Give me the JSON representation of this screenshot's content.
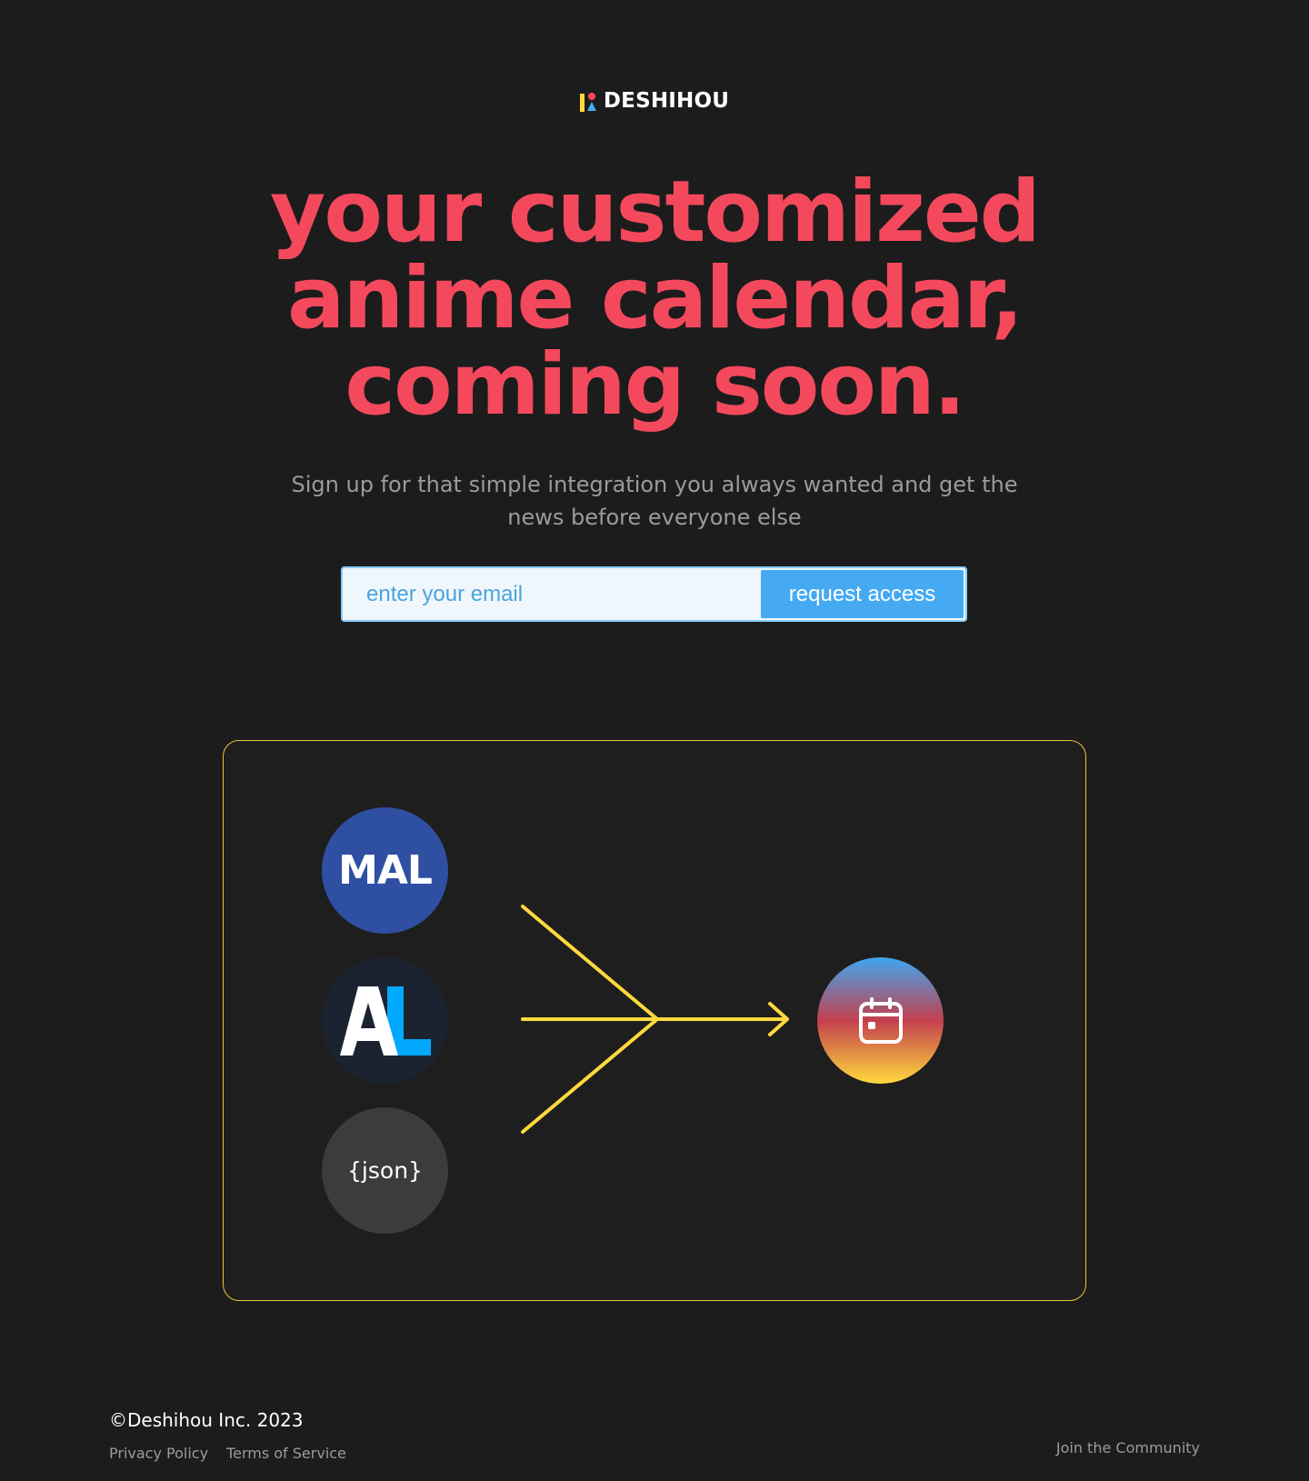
{
  "brand": {
    "name": "DESHIHOU",
    "logo_icon": "deshihou-logo-icon",
    "colors": {
      "accent_red": "#f4495d",
      "accent_yellow": "#ffd93d",
      "accent_blue": "#45aaf2"
    }
  },
  "hero": {
    "headline_lines": [
      "your customized",
      "anime calendar,",
      "coming soon."
    ],
    "subtitle": "Sign up for that simple integration you always wanted and get the news before everyone else"
  },
  "signup": {
    "email_placeholder": "enter your email",
    "email_value": "",
    "button_label": "request access"
  },
  "diagram": {
    "sources": [
      {
        "name": "MyAnimeList",
        "label": "MAL",
        "icon": "mal-logo-icon",
        "color": "#2f4fa2"
      },
      {
        "name": "AniList",
        "label": "AL",
        "icon": "anilist-logo-icon",
        "color": "#1b2330"
      },
      {
        "name": "JSON",
        "label": "{json}",
        "icon": "json-icon",
        "color": "#3c3c3c"
      }
    ],
    "arrow_icon": "merge-arrow-icon",
    "arrow_color": "#ffd93d",
    "target": {
      "icon": "calendar-icon"
    },
    "border_color": "#e8c43a"
  },
  "footer": {
    "copyright": "©Deshihou Inc. 2023",
    "links": [
      "Privacy Policy",
      "Terms of Service"
    ],
    "community": "Join the Community"
  }
}
